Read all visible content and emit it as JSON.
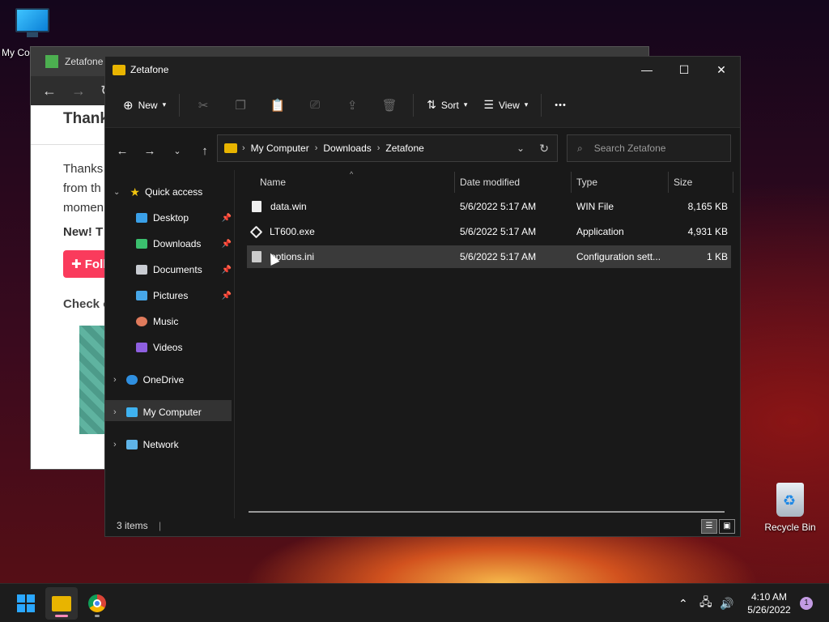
{
  "desktop": {
    "my_computer_label": "My Co",
    "recycle_bin_label": "Recycle Bin"
  },
  "browser": {
    "tab_title": "Zetafone",
    "heading": "Thank",
    "paragraph_lines": [
      "Thanks",
      "from th",
      "momen"
    ],
    "new_text": "New! T",
    "follow_label": "Foll",
    "check_text": "Check o"
  },
  "explorer": {
    "title": "Zetafone",
    "toolbar": {
      "new_label": "New",
      "sort_label": "Sort",
      "view_label": "View",
      "more_label": "•••"
    },
    "address": {
      "crumbs": [
        "My Computer",
        "Downloads",
        "Zetafone"
      ]
    },
    "search_placeholder": "Search Zetafone",
    "nav": {
      "quick_access": "Quick access",
      "items": [
        {
          "label": "Desktop",
          "pinned": true,
          "icon": "desktop-icon",
          "color": "#3aa0e8"
        },
        {
          "label": "Downloads",
          "pinned": true,
          "icon": "download-icon",
          "color": "#3bbf6e"
        },
        {
          "label": "Documents",
          "pinned": true,
          "icon": "document-icon",
          "color": "#c9ccd2"
        },
        {
          "label": "Pictures",
          "pinned": true,
          "icon": "picture-icon",
          "color": "#47a7e8"
        },
        {
          "label": "Music",
          "pinned": false,
          "icon": "music-icon",
          "color": "#e07b5c"
        },
        {
          "label": "Videos",
          "pinned": false,
          "icon": "video-icon",
          "color": "#8e5fe0"
        }
      ],
      "onedrive": "OneDrive",
      "my_computer": "My Computer",
      "network": "Network"
    },
    "columns": {
      "name": "Name",
      "date": "Date modified",
      "type": "Type",
      "size": "Size"
    },
    "files": [
      {
        "name": "data.win",
        "date": "5/6/2022 5:17 AM",
        "type": "WIN File",
        "size": "8,165 KB"
      },
      {
        "name": "LT600.exe",
        "date": "5/6/2022 5:17 AM",
        "type": "Application",
        "size": "4,931 KB"
      },
      {
        "name": "options.ini",
        "date": "5/6/2022 5:17 AM",
        "type": "Configuration sett...",
        "size": "1 KB"
      }
    ],
    "status": "3 items"
  },
  "taskbar": {
    "time": "4:10 AM",
    "date": "5/26/2022",
    "notification_count": "1"
  }
}
